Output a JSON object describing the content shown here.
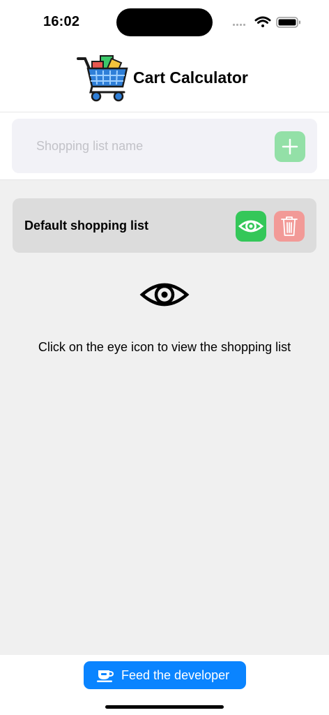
{
  "status_bar": {
    "time": "16:02",
    "icons": [
      "signal-icon",
      "wifi-icon",
      "battery-icon"
    ]
  },
  "header": {
    "title": "Cart Calculator",
    "logo_icon": "shopping-cart-logo-icon"
  },
  "new_list": {
    "placeholder": "Shopping list name",
    "value": "",
    "add_icon": "plus-icon",
    "add_button_color": "#93e0a7"
  },
  "lists": [
    {
      "name": "Default shopping list",
      "view_icon": "eye-icon",
      "delete_icon": "trash-icon"
    }
  ],
  "hint": {
    "icon": "eye-icon",
    "text": "Click on the eye icon to view the shopping list"
  },
  "footer": {
    "button_label": "Feed the developer",
    "button_icon": "coffee-cup-icon",
    "button_color": "#0a84ff"
  },
  "colors": {
    "view_green": "#34c759",
    "delete_red": "#f29a97",
    "content_background": "#f0f0f0",
    "row_background": "#dcdcdc"
  }
}
